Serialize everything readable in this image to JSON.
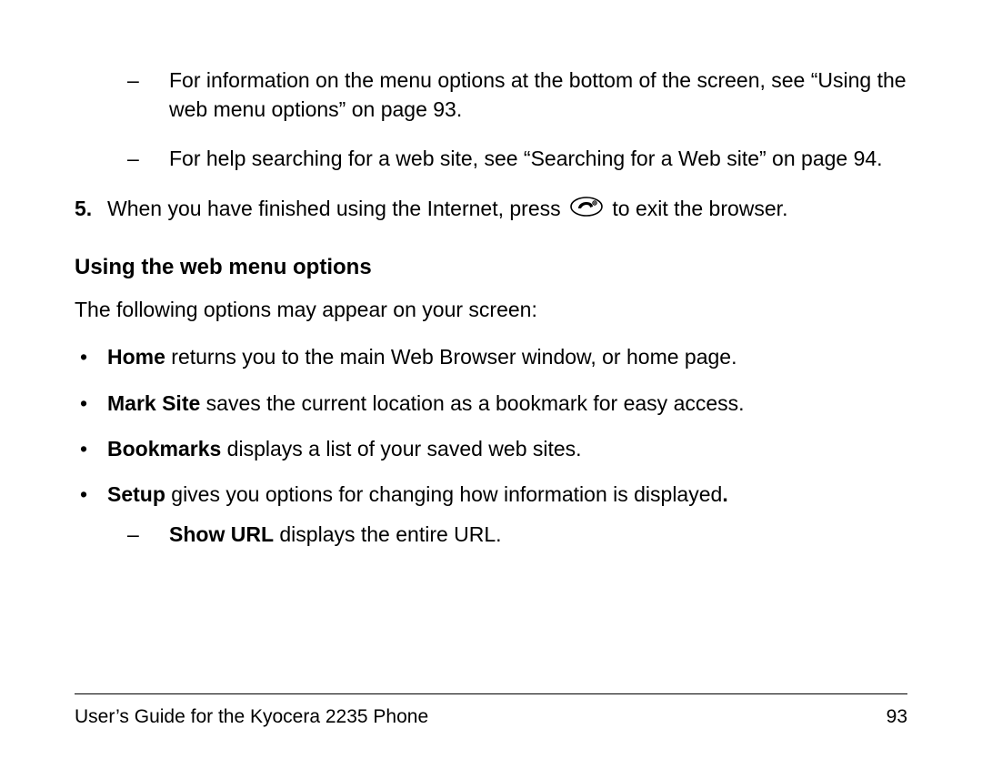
{
  "dashItems": [
    "For information on the menu options at the bottom of the screen, see “Using the web menu options” on page 93.",
    "For help searching for a web site, see “Searching for a Web site” on page 94."
  ],
  "step5": {
    "num": "5.",
    "before": "When you have finished using the Internet, press ",
    "after": " to exit the browser."
  },
  "heading": "Using the web menu options",
  "intro": "The following options may appear on your screen:",
  "bullets": [
    {
      "bold": "Home",
      "rest": " returns you to the main Web Browser window, or home page."
    },
    {
      "bold": "Mark Site",
      "rest": " saves the current location as a bookmark for easy access."
    },
    {
      "bold": "Bookmarks",
      "rest": " displays a list of your saved web sites."
    },
    {
      "bold": "Setup",
      "rest": " gives you options for changing how information is displayed",
      "trailBold": "."
    }
  ],
  "subDash": {
    "bold": "Show URL",
    "rest": " displays the entire URL."
  },
  "footer": {
    "title": "User’s Guide for the Kyocera 2235 Phone",
    "page": "93"
  },
  "marker": {
    "dash": "–",
    "bullet": "•"
  }
}
